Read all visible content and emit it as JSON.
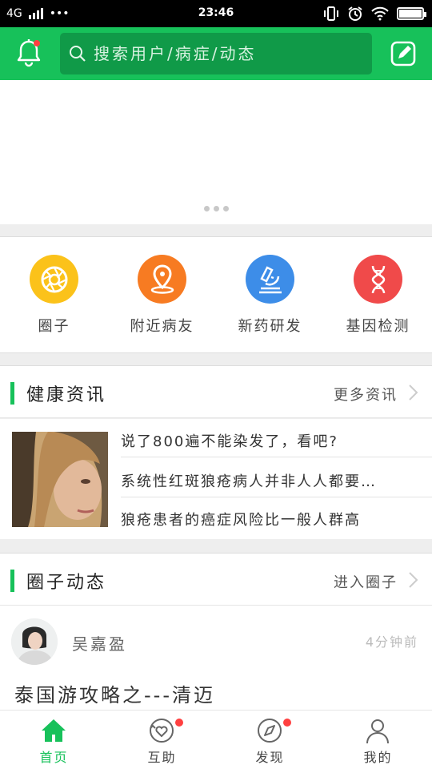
{
  "status_bar": {
    "network": "4G",
    "dots": "•••",
    "time": "23:46"
  },
  "header": {
    "search_placeholder": "搜索用户/病症/动态"
  },
  "banner": {
    "page_dots": 3
  },
  "categories": [
    {
      "label": "圈子",
      "icon": "aperture-icon",
      "color": "#fbc21a"
    },
    {
      "label": "附近病友",
      "icon": "location-pin-icon",
      "color": "#f77b22"
    },
    {
      "label": "新药研发",
      "icon": "microscope-icon",
      "color": "#3d8de8"
    },
    {
      "label": "基因检测",
      "icon": "dna-icon",
      "color": "#f04a4a"
    }
  ],
  "news_section": {
    "title": "健康资讯",
    "more": "更多资讯",
    "items": [
      "说了800遍不能染发了，看吧?",
      "系统性红斑狼疮病人并非人人都要…",
      "狼疮患者的癌症风险比一般人群高"
    ]
  },
  "circle_section": {
    "title": "圈子动态",
    "more": "进入圈子",
    "post": {
      "user": "吴嘉盈",
      "time": "4分钟前",
      "title": "泰国游攻略之---清迈"
    }
  },
  "bottom_nav": [
    {
      "label": "首页",
      "icon": "home-icon",
      "active": true,
      "badge": false
    },
    {
      "label": "互助",
      "icon": "heart-exchange-icon",
      "active": false,
      "badge": true
    },
    {
      "label": "发现",
      "icon": "compass-icon",
      "active": false,
      "badge": true
    },
    {
      "label": "我的",
      "icon": "person-icon",
      "active": false,
      "badge": false
    }
  ],
  "colors": {
    "brand_green": "#17c15a",
    "search_bg": "#109a48",
    "badge_red": "#ff4040"
  }
}
